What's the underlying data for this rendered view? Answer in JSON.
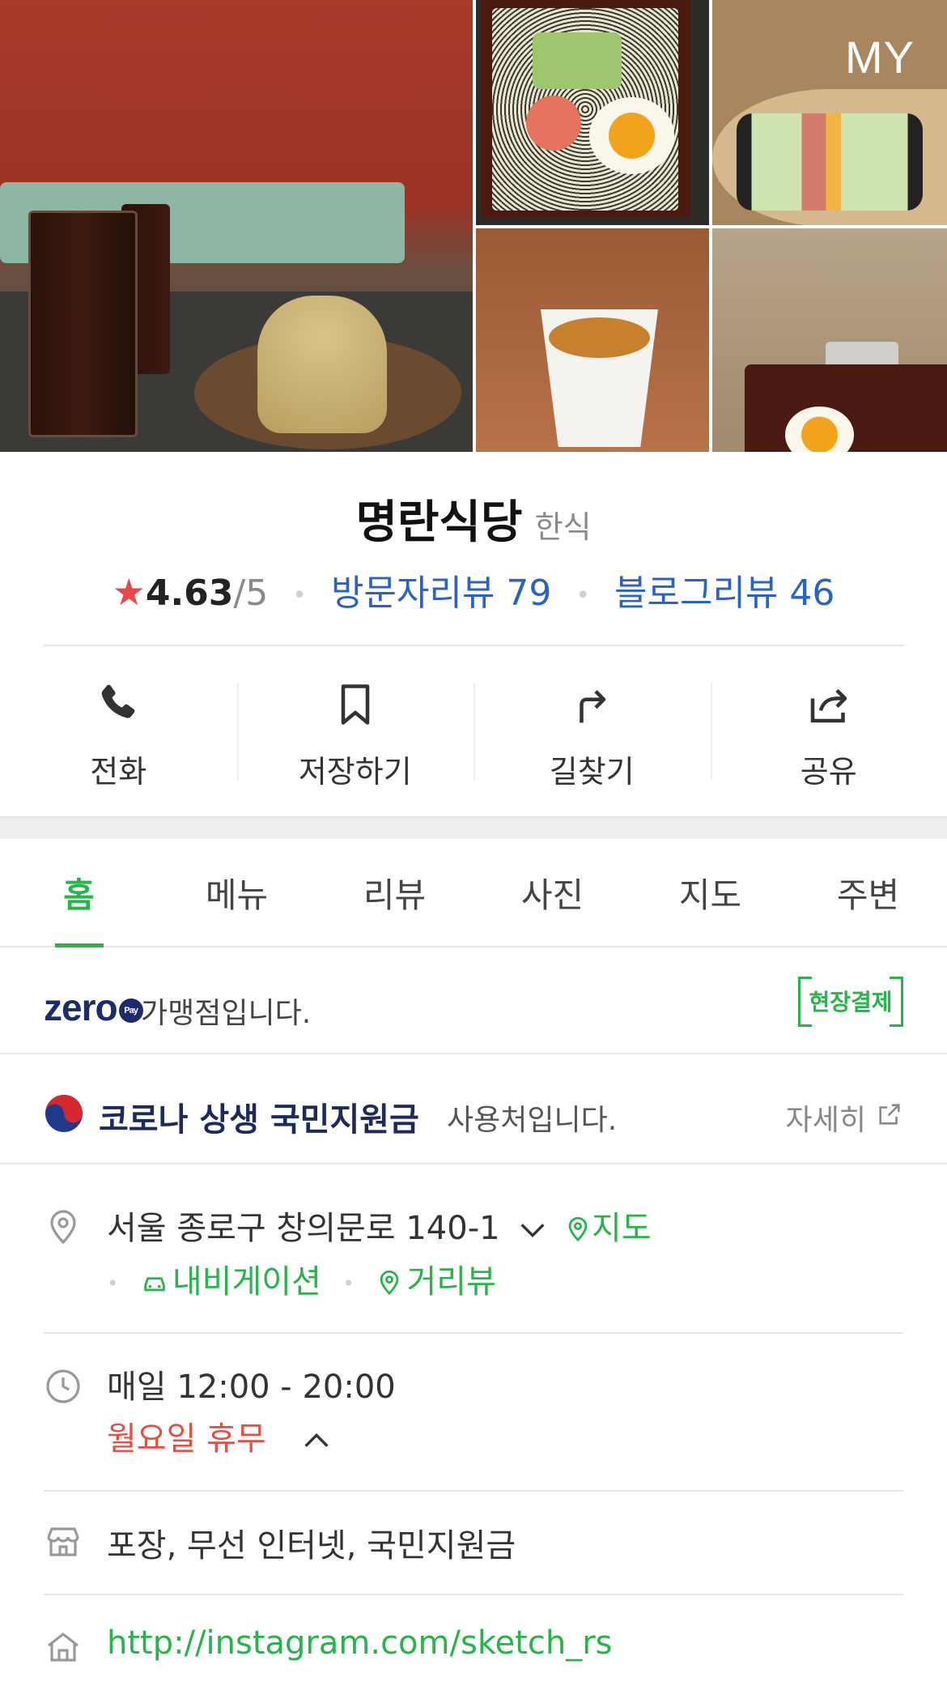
{
  "photos": {
    "badge": "MY"
  },
  "place": {
    "name": "명란식당",
    "category": "한식",
    "rating": "4.63",
    "rating_max": "/5",
    "visitor_reviews": "방문자리뷰 79",
    "blog_reviews": "블로그리뷰 46"
  },
  "actions": [
    {
      "label": "전화",
      "icon": "phone-icon"
    },
    {
      "label": "저장하기",
      "icon": "bookmark-icon"
    },
    {
      "label": "길찾기",
      "icon": "directions-icon"
    },
    {
      "label": "공유",
      "icon": "share-icon"
    }
  ],
  "tabs": [
    {
      "label": "홈",
      "active": true
    },
    {
      "label": "메뉴"
    },
    {
      "label": "리뷰"
    },
    {
      "label": "사진"
    },
    {
      "label": "지도"
    },
    {
      "label": "주변"
    }
  ],
  "zeropay": {
    "logo": "zero",
    "logo_pay": "Pay",
    "text": "가맹점입니다.",
    "badge": "현장결제"
  },
  "covid": {
    "title": "코로나 상생 국민지원금",
    "text": "사용처입니다.",
    "link": "자세히"
  },
  "address": {
    "text": "서울 종로구 창의문로 140-1",
    "map": "지도",
    "navigation": "내비게이션",
    "streetview": "거리뷰"
  },
  "hours": {
    "text": "매일 12:00 - 20:00",
    "closed": "월요일 휴무"
  },
  "amenities": {
    "text": "포장, 무선 인터넷, 국민지원금"
  },
  "website": {
    "url": "http://instagram.com/sketch_rs"
  },
  "colors": {
    "accent_green": "#28b34b",
    "link_blue": "#2a63c6",
    "star_red": "#e5484d",
    "closed_red": "#e44f42"
  }
}
